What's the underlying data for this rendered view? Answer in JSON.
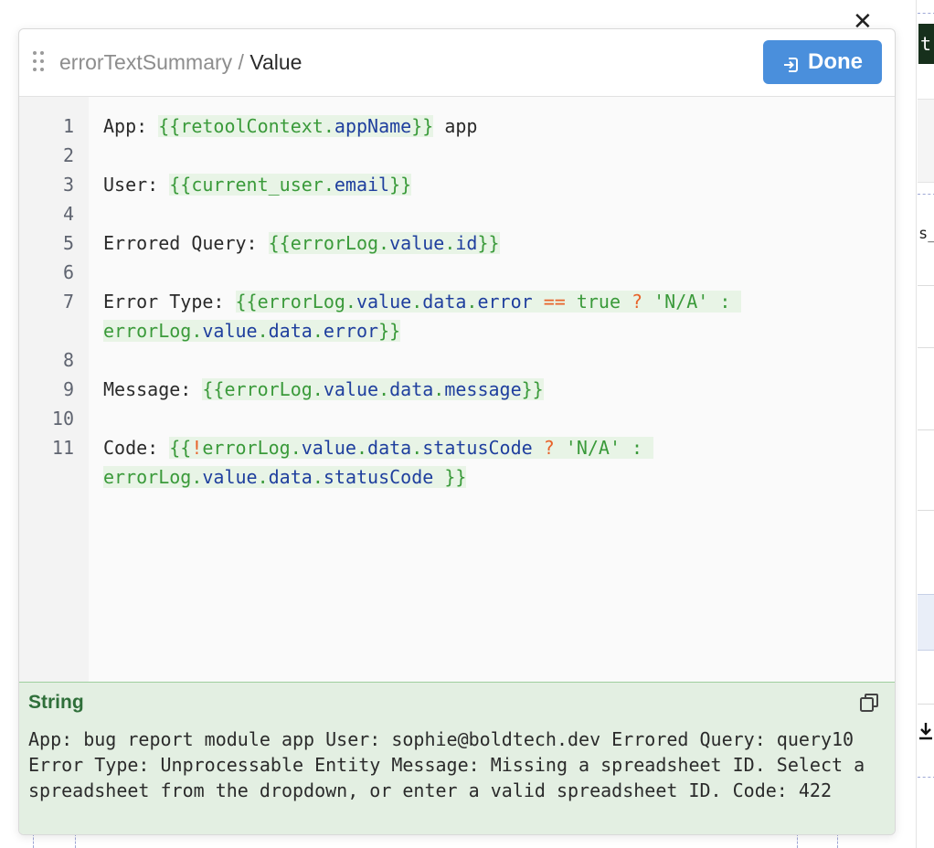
{
  "background": {
    "close_glyph": "✕",
    "strip_fragment_top": "t a",
    "strip_fragment_mid": "s_",
    "download_icon": "download-icon"
  },
  "header": {
    "component_name": "errorTextSummary",
    "separator": " / ",
    "property_name": "Value",
    "done_label": "Done",
    "done_icon": "enter-icon",
    "drag_icon": "drag-handle-icon"
  },
  "editor": {
    "line_numbers": [
      "1",
      "2",
      "3",
      "4",
      "5",
      "6",
      "7",
      "8",
      "9",
      "10",
      "11"
    ],
    "lines": {
      "l1_prefix": "App: ",
      "l1_open": "{{",
      "l1_obj": "retoolContext",
      "l1_dot": ".",
      "l1_prop": "appName",
      "l1_close": "}}",
      "l1_suffix": " app",
      "l3_prefix": "User: ",
      "l3_open": "{{",
      "l3_obj": "current_user",
      "l3_dot": ".",
      "l3_prop": "email",
      "l3_close": "}}",
      "l5_prefix": "Errored Query: ",
      "l5_open": "{{",
      "l5_obj": "errorLog",
      "l5_d1": ".",
      "l5_p1": "value",
      "l5_d2": ".",
      "l5_p2": "id",
      "l5_close": "}}",
      "l7_prefix": "Error Type: ",
      "l7_open": "{{",
      "l7_obj": "errorLog",
      "l7_d1": ".",
      "l7_p1": "value",
      "l7_d2": ".",
      "l7_p2": "data",
      "l7_d3": ".",
      "l7_p3": "error",
      "l7_eq": " == ",
      "l7_true": "true",
      "l7_q": " ? ",
      "l7_str": "'N/A'",
      "l7_colon": " : ",
      "l7b_obj": "errorLog",
      "l7b_d1": ".",
      "l7b_p1": "value",
      "l7b_d2": ".",
      "l7b_p2": "data",
      "l7b_d3": ".",
      "l7b_p3": "error",
      "l7b_close": "}}",
      "l9_prefix": "Message: ",
      "l9_open": "{{",
      "l9_obj": "errorLog",
      "l9_d1": ".",
      "l9_p1": "value",
      "l9_d2": ".",
      "l9_p2": "data",
      "l9_d3": ".",
      "l9_p3": "message",
      "l9_close": "}}",
      "l11_prefix": "Code: ",
      "l11_open": "{{",
      "l11_not": "!",
      "l11_obj": "errorLog",
      "l11_d1": ".",
      "l11_p1": "value",
      "l11_d2": ".",
      "l11_p2": "data",
      "l11_d3": ".",
      "l11_p3": "statusCode",
      "l11_q": " ? ",
      "l11_str": "'N/A'",
      "l11_colon": " : ",
      "l11b_obj": "errorLog",
      "l11b_d1": ".",
      "l11b_p1": "value",
      "l11b_d2": ".",
      "l11b_p2": "data",
      "l11b_d3": ".",
      "l11b_p3": "statusCode",
      "l11b_close": " }}"
    }
  },
  "result": {
    "type_label": "String",
    "copy_icon": "copy-icon",
    "value": "App: bug report module app User: sophie@boldtech.dev Errored Query: query10 Error Type: Unprocessable Entity Message: Missing a spreadsheet ID. Select a spreadsheet from the dropdown, or enter a valid spreadsheet ID. Code: 422"
  },
  "colors": {
    "done_button": "#4a8fdc",
    "template_brace": "#3a9a3a",
    "template_property": "#1f3f9e",
    "operator": "#e8632a",
    "result_bg": "#e3efe2",
    "result_type": "#2f6f3a"
  }
}
